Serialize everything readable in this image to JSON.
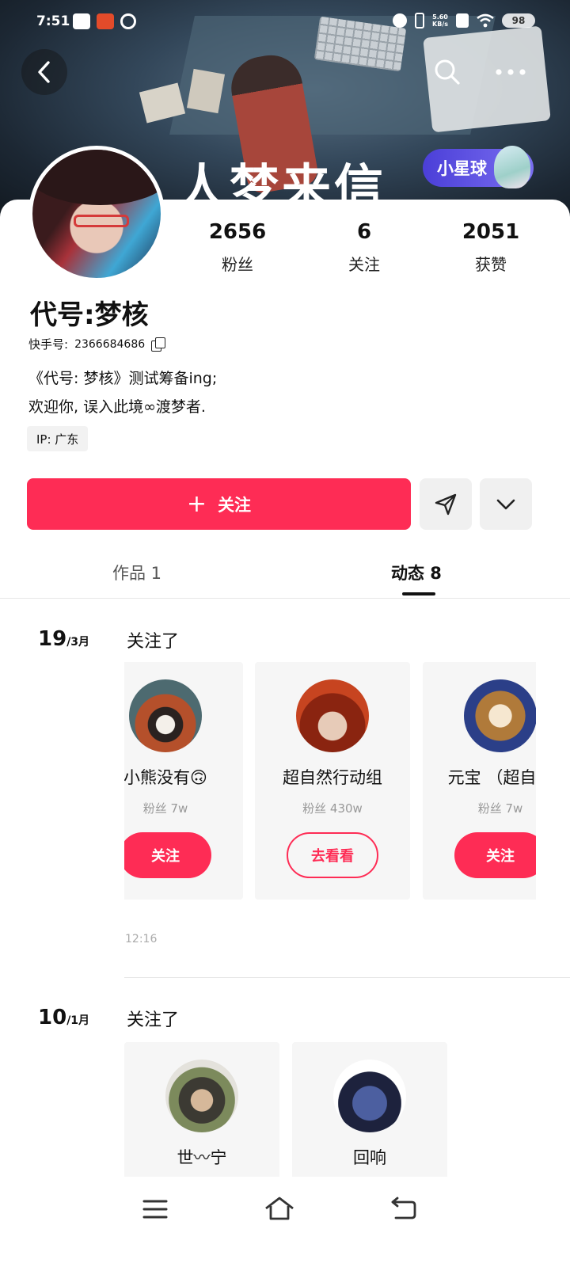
{
  "status_bar": {
    "time": "7:51",
    "net_speed": "5.60",
    "net_unit": "KB/s",
    "battery": "98"
  },
  "banner": {
    "title_text": "人梦来信",
    "badge_label": "小星球"
  },
  "stats": [
    {
      "value": "2656",
      "label": "粉丝"
    },
    {
      "value": "6",
      "label": "关注"
    },
    {
      "value": "2051",
      "label": "获赞"
    }
  ],
  "profile": {
    "name": "代号:梦核",
    "kuaishou_id_label": "快手号:",
    "kuaishou_id": "2366684686",
    "bio_line1": "《代号: 梦核》测试筹备ing;",
    "bio_line2": "欢迎你, 误入此境∞渡梦者.",
    "ip": "IP:  广东"
  },
  "actions": {
    "follow_label": "关注"
  },
  "tabs": [
    {
      "label": "作品  1"
    },
    {
      "label": "动态  8"
    }
  ],
  "feed": [
    {
      "day": "19",
      "month": "/3月",
      "title": "关注了",
      "time": "12:16",
      "users": [
        {
          "name": "小熊没有🙃",
          "fans": "粉丝  7w",
          "button": "关注"
        },
        {
          "name": "超自然行动组",
          "fans": "粉丝  430w",
          "button": "去看看"
        },
        {
          "name": "元宝 （超自然",
          "fans": "粉丝  7w",
          "button": "关注"
        }
      ]
    },
    {
      "day": "10",
      "month": "/1月",
      "title": "关注了",
      "users": [
        {
          "name": "世〰宁"
        },
        {
          "name": "回响"
        }
      ]
    }
  ],
  "colors": {
    "accent": "#fe2c55",
    "badge": "#4b3fd8"
  }
}
